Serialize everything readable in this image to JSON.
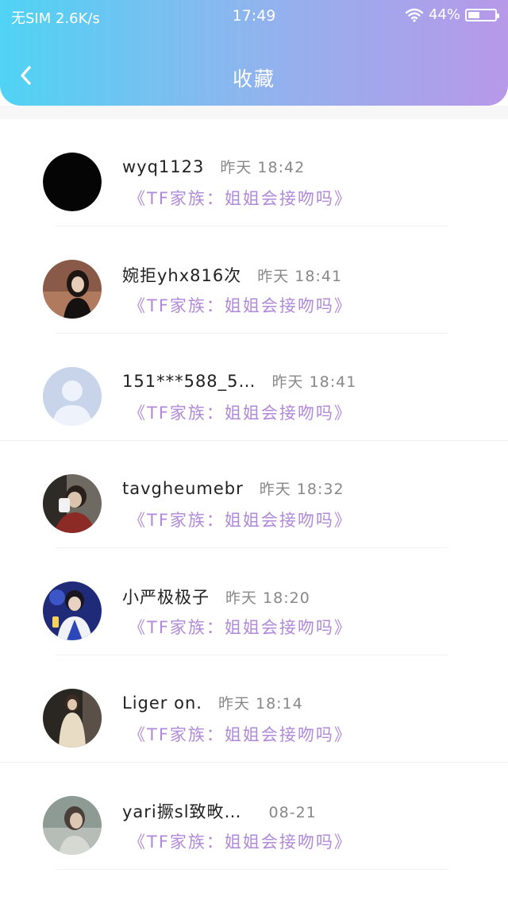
{
  "status_bar": {
    "carrier": "无SIM 2.6K/s",
    "time": "17:49",
    "battery": "44%",
    "icons": [
      "wifi-icon",
      "battery-icon"
    ]
  },
  "header": {
    "title": "收藏",
    "back_icon": "chevron-left-icon"
  },
  "colors": {
    "header_gradient_start": "#4fd3f4",
    "header_gradient_end": "#b898e9",
    "subtitle": "#b08ad8",
    "time_text": "#888888"
  },
  "favorites": [
    {
      "name": "wyq1123",
      "time": "昨天 18:42",
      "subtitle": "《TF家族：姐姐会接吻吗》"
    },
    {
      "name": "婉拒yhx816次",
      "time": "昨天 18:41",
      "subtitle": "《TF家族：姐姐会接吻吗》"
    },
    {
      "name": "151***588_5…",
      "time": "昨天 18:41",
      "subtitle": "《TF家族：姐姐会接吻吗》"
    },
    {
      "name": "tavgheumebr",
      "time": "昨天 18:32",
      "subtitle": "《TF家族：姐姐会接吻吗》"
    },
    {
      "name": "小严极极子",
      "time": "昨天 18:20",
      "subtitle": "《TF家族：姐姐会接吻吗》"
    },
    {
      "name": "Liger on.",
      "time": "昨天 18:14",
      "subtitle": "《TF家族：姐姐会接吻吗》"
    },
    {
      "name": "yari撅sl致畋…",
      "time": "08-21",
      "subtitle": "《TF家族：姐姐会接吻吗》"
    }
  ]
}
